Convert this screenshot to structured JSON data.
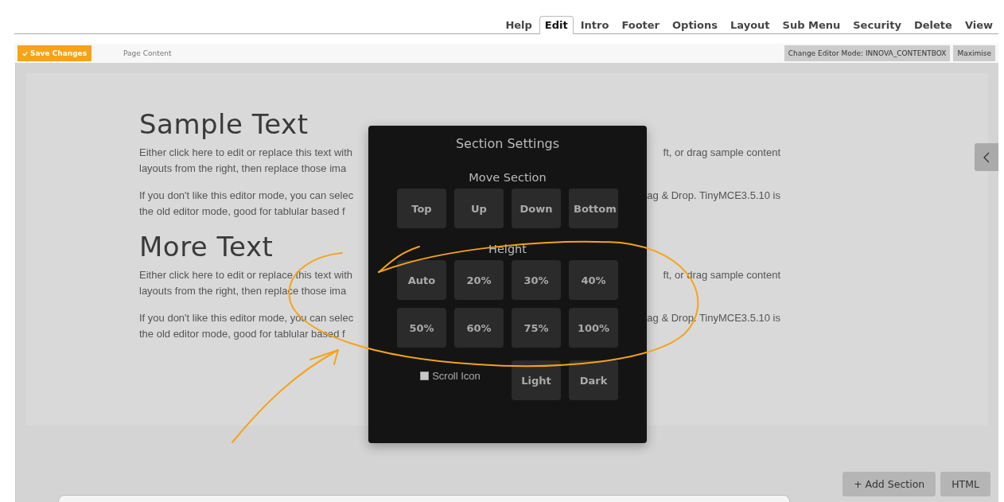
{
  "tabs": [
    {
      "label": "Help",
      "selected": false
    },
    {
      "label": "Edit",
      "selected": true
    },
    {
      "label": "Intro",
      "selected": false
    },
    {
      "label": "Footer",
      "selected": false
    },
    {
      "label": "Options",
      "selected": false
    },
    {
      "label": "Layout",
      "selected": false
    },
    {
      "label": "Sub Menu",
      "selected": false
    },
    {
      "label": "Security",
      "selected": false
    },
    {
      "label": "Delete",
      "selected": false
    },
    {
      "label": "View",
      "selected": false
    }
  ],
  "toolbar": {
    "save_button": "Save Changes",
    "label": "Page Content",
    "mode_button": "Change Editor Mode: INNOVA_CONTENTBOX",
    "maximise_button": "Maximise"
  },
  "content": [
    {
      "kind": "heading",
      "text": "Sample Text"
    },
    {
      "kind": "paragraph",
      "lines": [
        {
          "left": "Either click here to edit or replace this text with",
          "right": "ft, or drag sample content"
        },
        {
          "left": "layouts from the right, then replace those ima"
        }
      ]
    },
    {
      "kind": "paragraph",
      "lines": [
        {
          "left": "If you don't like this editor mode, you can selec",
          "right": "ag & Drop. TinyMCE3.5.10 is"
        },
        {
          "left": "the old editor mode, good for tablular based f"
        }
      ]
    },
    {
      "kind": "heading",
      "text": "More Text"
    },
    {
      "kind": "paragraph",
      "lines": [
        {
          "left": "Either click here to edit or replace this text with",
          "right": "ft, or drag sample content"
        },
        {
          "left": "layouts from the right, then replace those ima"
        }
      ]
    },
    {
      "kind": "paragraph",
      "lines": [
        {
          "left": "If you don't like this editor mode, you can selec",
          "right": "ag & Drop. TinyMCE3.5.10 is"
        },
        {
          "left": "the old editor mode, good for tablular based f"
        }
      ]
    }
  ],
  "section_settings": {
    "title": "Section Settings",
    "move_heading": "Move Section",
    "move_buttons": [
      "Top",
      "Up",
      "Down",
      "Bottom"
    ],
    "height_heading": "Height",
    "height_buttons": [
      "Auto",
      "20%",
      "30%",
      "40%",
      "50%",
      "60%",
      "75%",
      "100%"
    ],
    "scroll_icon": {
      "label": "Scroll Icon",
      "checked": false
    },
    "theme_buttons": [
      "Light",
      "Dark"
    ]
  },
  "bottom_buttons": [
    "+ Add Section",
    "HTML"
  ]
}
